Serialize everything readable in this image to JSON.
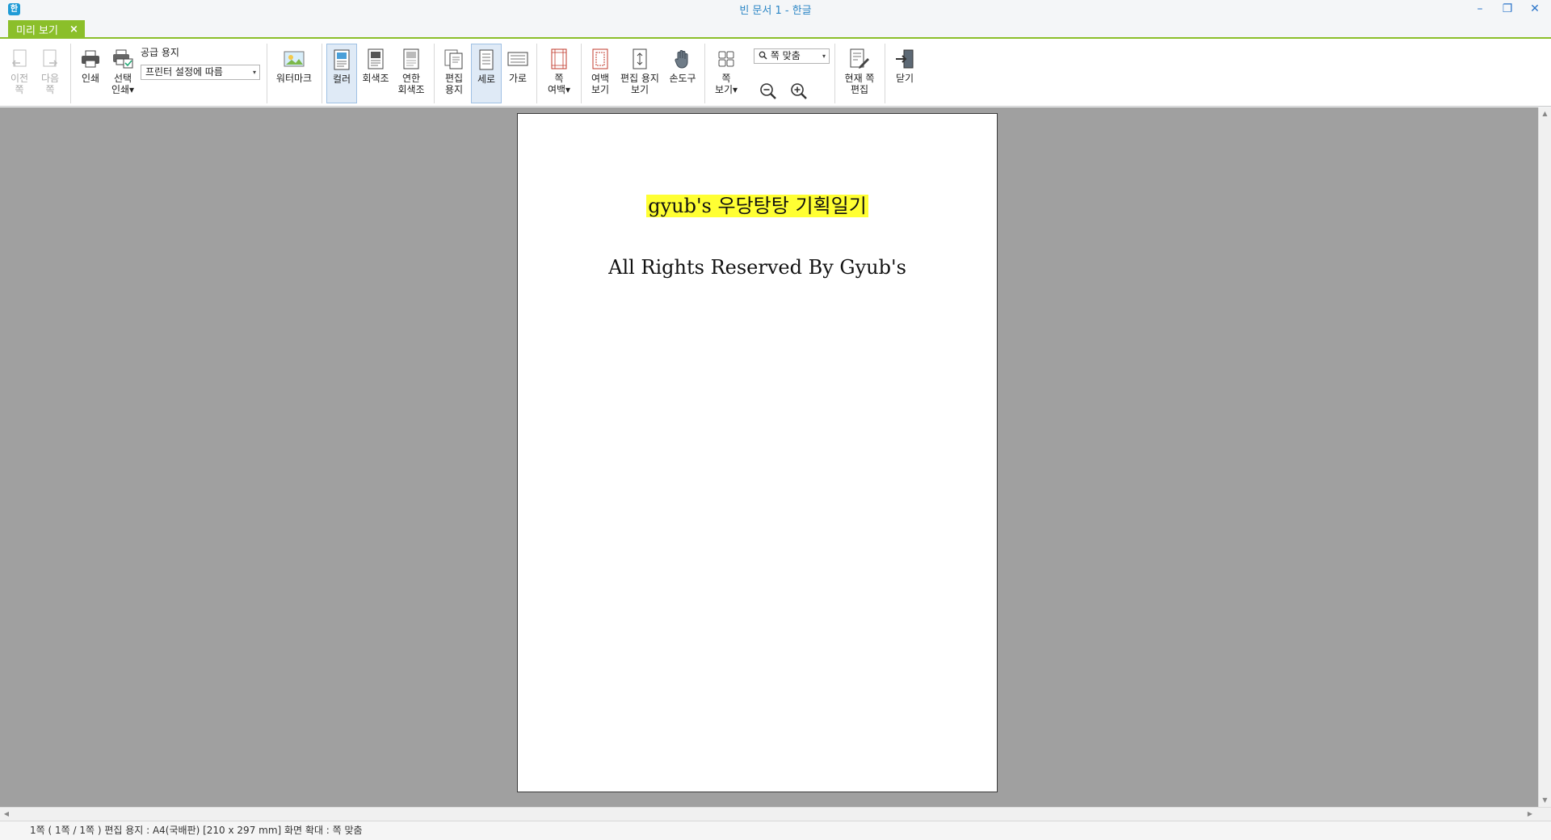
{
  "window": {
    "title": "빈 문서 1 - 한글",
    "app_icon": "한",
    "controls": {
      "minimize": "–",
      "restore": "❐",
      "close": "✕"
    }
  },
  "tab": {
    "label": "미리 보기",
    "close": "×"
  },
  "ribbon": {
    "prev_page": "이전\n쪽",
    "next_page": "다음\n쪽",
    "print": "인쇄",
    "select_print": "선택\n인쇄▾",
    "paper_label": "공급 용지",
    "paper_value": "프린터 설정에 따름",
    "watermark": "워터마크",
    "color": "컬러",
    "grayscale": "회색조",
    "light_grayscale": "연한\n회색조",
    "edit_paper": "편집\n용지",
    "portrait": "세로",
    "landscape": "가로",
    "page_margin": "쪽\n여백▾",
    "margin_view": "여백\n보기",
    "edit_paper_view": "편집 용지\n보기",
    "hand_tool": "손도구",
    "page_view": "쪽\n보기▾",
    "zoom_value": "쪽 맞춤",
    "edit_current_page": "현재 쪽\n편집",
    "close": "닫기",
    "arrow": "▾",
    "colors": {
      "accent_green": "#8bbf2a",
      "selected_bg": "#dfeaf6",
      "highlight": "#ffff33"
    }
  },
  "document": {
    "title": "gyub's 우당탕탕 기획일기",
    "subtitle": "All Rights Reserved By Gyub's"
  },
  "status": {
    "text": "1쪽 ( 1쪽 / 1쪽 ) 편집 용지 : A4(국배판) [210 x 297 mm] 화면 확대 : 쪽 맞춤"
  }
}
